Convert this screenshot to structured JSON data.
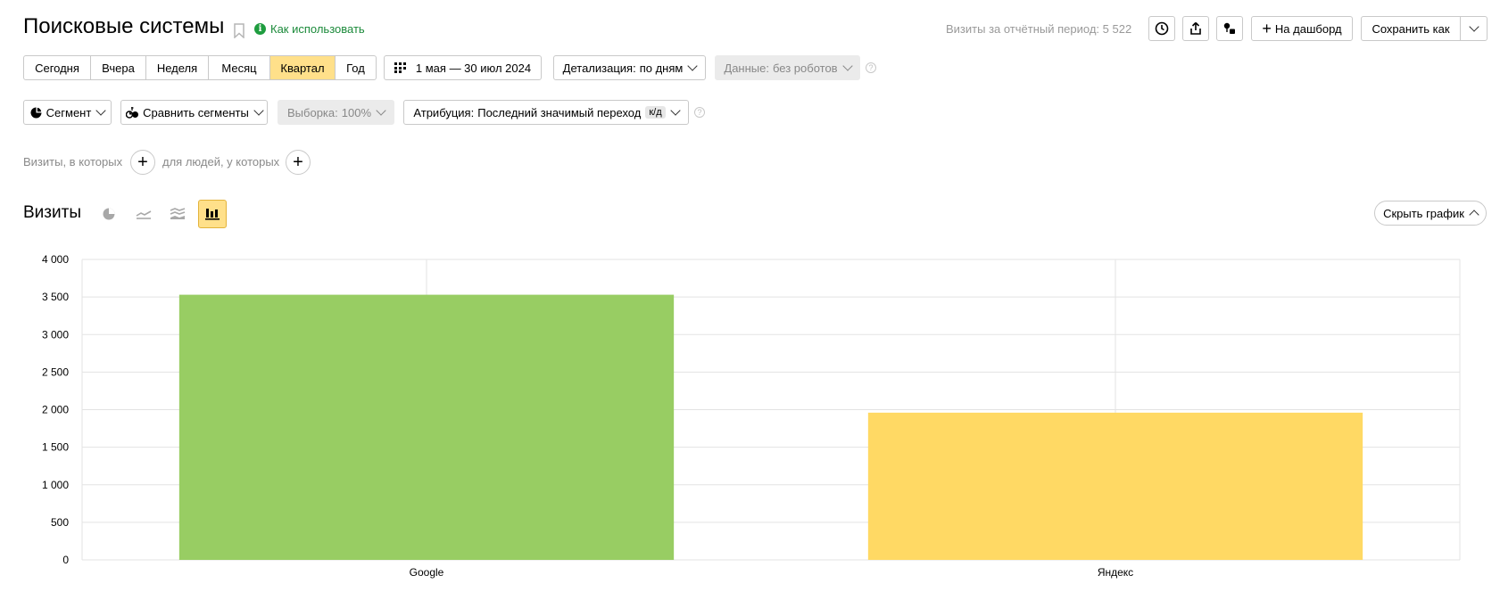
{
  "header": {
    "title": "Поисковые системы",
    "how_to_use": "Как использовать",
    "visits_period_label": "Визиты за отчётный период:",
    "visits_period_value": "5 522",
    "to_dashboard": "На дашборд",
    "save_as": "Сохранить как"
  },
  "period_buttons": [
    {
      "label": "Сегодня",
      "active": false
    },
    {
      "label": "Вчера",
      "active": false
    },
    {
      "label": "Неделя",
      "active": false
    },
    {
      "label": "Месяц",
      "active": false
    },
    {
      "label": "Квартал",
      "active": true
    },
    {
      "label": "Год",
      "active": false
    }
  ],
  "filters": {
    "date_range": "1 мая — 30 июл 2024",
    "detail_label": "Детализация:",
    "detail_value": "по дням",
    "data_label": "Данные:",
    "data_value": "без роботов",
    "segment": "Сегмент",
    "compare_segments": "Сравнить сегменты",
    "sample_label": "Выборка:",
    "sample_value": "100%",
    "attribution_label": "Атрибуция:",
    "attribution_value": "Последний значимый переход",
    "attribution_badge": "к/д"
  },
  "segment_builder": {
    "visits_where": "Визиты, в которых",
    "people_where": "для людей, у которых"
  },
  "chart_section": {
    "title": "Визиты",
    "hide_chart": "Скрыть график",
    "active_view": "bar-chart"
  },
  "chart_data": {
    "type": "bar",
    "categories": [
      "Google",
      "Яндекс"
    ],
    "values": [
      3530,
      1960
    ],
    "colors": [
      "#98cd63",
      "#ffd964"
    ],
    "ylim": [
      0,
      4000
    ],
    "yticks": [
      0,
      500,
      1000,
      1500,
      2000,
      2500,
      3000,
      3500,
      4000
    ],
    "ytick_labels": [
      "0",
      "500",
      "1 000",
      "1 500",
      "2 000",
      "2 500",
      "3 000",
      "3 500",
      "4 000"
    ],
    "grid": true
  }
}
